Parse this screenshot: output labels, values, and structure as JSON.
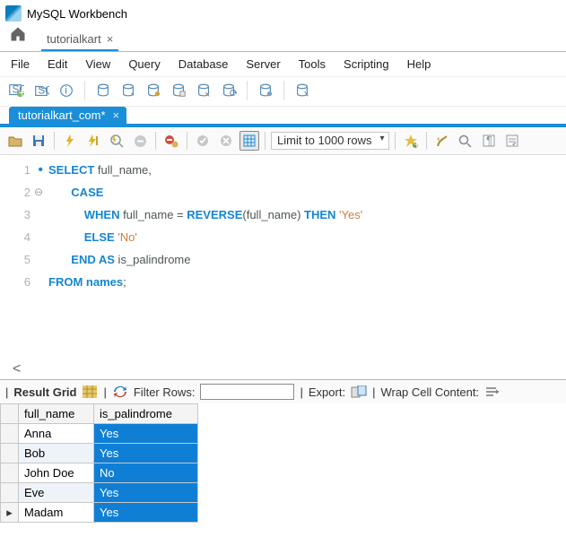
{
  "titlebar": {
    "text": "MySQL Workbench"
  },
  "connection_tab": {
    "label": "tutorialkart"
  },
  "menu": [
    "File",
    "Edit",
    "View",
    "Query",
    "Database",
    "Server",
    "Tools",
    "Scripting",
    "Help"
  ],
  "sql_tab": {
    "label": "tutorialkart_com*"
  },
  "limit_rows": "Limit to 1000 rows",
  "code": {
    "lines": [
      {
        "n": "1",
        "dot": true
      },
      {
        "n": "2",
        "fold": "⊖"
      },
      {
        "n": "3"
      },
      {
        "n": "4"
      },
      {
        "n": "5"
      },
      {
        "n": "6"
      }
    ],
    "l1_kw": "SELECT",
    "l1_id": " full_name,",
    "l2_kw": "CASE",
    "l3_kw1": "WHEN",
    "l3_id1": " full_name = ",
    "l3_kw2": "REVERSE",
    "l3_id2": "(full_name) ",
    "l3_kw3": "THEN",
    "l3_s": " 'Yes'",
    "l4_kw": "ELSE",
    "l4_s": " 'No'",
    "l5_kw": "END AS",
    "l5_id": " is_palindrome",
    "l6_kw1": "FROM",
    "l6_kw2": " names",
    "l6_semi": ";"
  },
  "result_bar": {
    "label": "Result Grid",
    "filter_label": "Filter Rows:",
    "export_label": "Export:",
    "wrap_label": "Wrap Cell Content:"
  },
  "grid": {
    "headers": [
      "full_name",
      "is_palindrome"
    ],
    "rows": [
      {
        "c1": "Anna",
        "c2": "Yes"
      },
      {
        "c1": "Bob",
        "c2": "Yes"
      },
      {
        "c1": "John Doe",
        "c2": "No"
      },
      {
        "c1": "Eve",
        "c2": "Yes"
      },
      {
        "c1": "Madam",
        "c2": "Yes"
      }
    ],
    "row_marker": "▸"
  }
}
